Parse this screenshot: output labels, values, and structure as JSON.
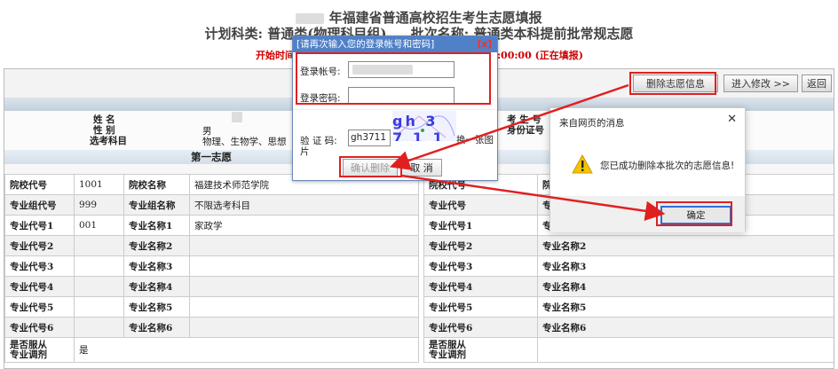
{
  "header": {
    "title": "年福建省普通高校招生考生志愿填报",
    "plan_label": "计划科类:",
    "plan_value": "普通类(物理科目组)",
    "batch_label": "批次名称:",
    "batch_value": "普通类本科提前批常规志愿",
    "time_prefix": "开始时间",
    "time_suffix": ":00:00 (正在填报)"
  },
  "toolbar": {
    "delete_label": "删除志愿信息",
    "modify_label": "进入修改 >>",
    "back_label": "返回"
  },
  "student": {
    "name_label": "姓 名",
    "gender_label": "性 别",
    "gender_value": "男",
    "subjects_label": "选考科目",
    "subjects_value": "物理、生物学、思想",
    "exam_no_label": "考 生 号",
    "id_label": "身份证号"
  },
  "section": {
    "first_choice": "第一志愿"
  },
  "left_table": [
    [
      "院校代号",
      "1001",
      "院校名称",
      "福建技术师范学院"
    ],
    [
      "专业组代号",
      "999",
      "专业组名称",
      "不限选考科目"
    ],
    [
      "专业代号1",
      "001",
      "专业名称1",
      "家政学"
    ],
    [
      "专业代号2",
      "",
      "专业名称2",
      ""
    ],
    [
      "专业代号3",
      "",
      "专业名称3",
      ""
    ],
    [
      "专业代号4",
      "",
      "专业名称4",
      ""
    ],
    [
      "专业代号5",
      "",
      "专业名称5",
      ""
    ],
    [
      "专业代号6",
      "",
      "专业名称6",
      ""
    ]
  ],
  "adjust": {
    "label1": "是否服从",
    "label2": "专业调剂",
    "value": "是"
  },
  "right_table": [
    [
      "院校代号",
      "院"
    ],
    [
      "专业代号",
      "专"
    ],
    [
      "专业代号1",
      "专"
    ],
    [
      "专业代号2",
      "专业名称2"
    ],
    [
      "专业代号3",
      "专业名称3"
    ],
    [
      "专业代号4",
      "专业名称4"
    ],
    [
      "专业代号5",
      "专业名称5"
    ],
    [
      "专业代号6",
      "专业名称6"
    ]
  ],
  "login_dialog": {
    "title": "[请再次输入您的登录帐号和密码]",
    "close": "[x]",
    "account_label": "登录帐号:",
    "password_label": "登录密码:",
    "captcha_label": "验 证 码:",
    "captcha_label2": "片",
    "captcha_value": "gh3711",
    "captcha_image_text": "gh 3 7 1 1",
    "refresh_label": "换一张图",
    "confirm_label": "确认删除",
    "cancel_label": "取 消"
  },
  "message_box": {
    "title": "来自网页的消息",
    "close": "✕",
    "text": "您已成功删除本批次的志愿信息!",
    "ok_label": "确定",
    "icon": "warning-icon"
  },
  "colors": {
    "accent_red": "#e02020",
    "dialog_blue": "#4f80c8",
    "ok_blue": "#2f6fd6"
  }
}
